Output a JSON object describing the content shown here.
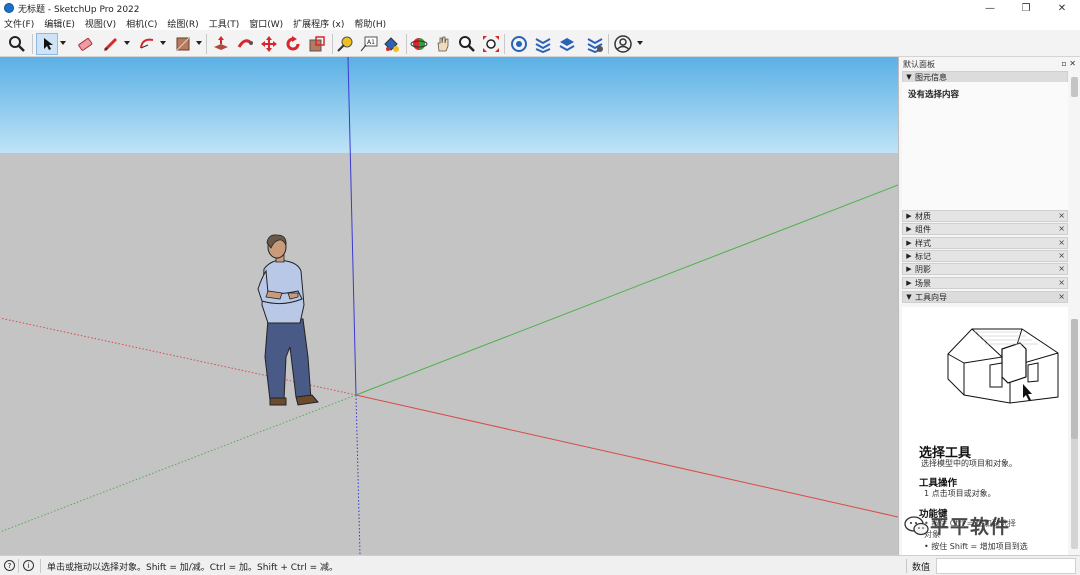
{
  "window": {
    "title": "无标题 - SketchUp Pro 2022",
    "minimize": "—",
    "maximize": "❐",
    "close": "✕"
  },
  "menu": [
    "文件(F)",
    "编辑(E)",
    "视图(V)",
    "相机(C)",
    "绘图(R)",
    "工具(T)",
    "窗口(W)",
    "扩展程序 (x)",
    "帮助(H)"
  ],
  "toolbar": {
    "icons": [
      "search-icon",
      "select-arrow-icon",
      "eraser-icon",
      "pencil-line-icon",
      "arc-icon",
      "shape-rectangle-icon",
      "push-pull-icon",
      "follow-me-icon",
      "move-icon",
      "rotate-icon",
      "scale-icon",
      "tape-measure-icon",
      "text-label-icon",
      "paint-bucket-icon",
      "orbit-icon",
      "pan-icon",
      "zoom-icon",
      "zoom-extents-icon",
      "3d-warehouse-icon",
      "extension-warehouse-icon",
      "layout-icon",
      "extension-manager-icon",
      "user-account-icon"
    ],
    "text_tool_label": "A1",
    "colors": {
      "active_bg": "#cfe3f7",
      "red": "#d6282b",
      "blue": "#2a62b8"
    }
  },
  "viewport": {
    "colors": {
      "sky_top": "#5ab0e6",
      "sky_bottom": "#bfe3f6",
      "ground": "#c4c4c4",
      "axis_red": "#d84a4a",
      "axis_green": "#4bb24b",
      "axis_blue": "#3a3ad0"
    }
  },
  "panel": {
    "title": "默认面板",
    "controls": "▫ ✕",
    "entity_info": {
      "label": "图元信息",
      "empty_text": "没有选择内容"
    },
    "trays": [
      "材质",
      "组件",
      "样式",
      "标记",
      "阴影",
      "场景",
      "工具向导"
    ],
    "close_symbol": "×",
    "guide": {
      "heading": "选择工具",
      "subtitle": "选择模型中的项目和对象。",
      "ops_heading": "工具操作",
      "ops_step": "1  点击项目或对象。",
      "func_heading": "功能键",
      "func_line1": "• 按住 Ctrl = 增加到选择",
      "func_line2": "对象",
      "func_line3": "• 按住 Shift = 增加项目到选"
    }
  },
  "watermark": {
    "text": "平平软件"
  },
  "statusbar": {
    "hint": "单击或拖动以选择对象。Shift = 加/减。Ctrl = 加。Shift + Ctrl = 减。",
    "measurements_label": "数值",
    "measurements_value": ""
  }
}
